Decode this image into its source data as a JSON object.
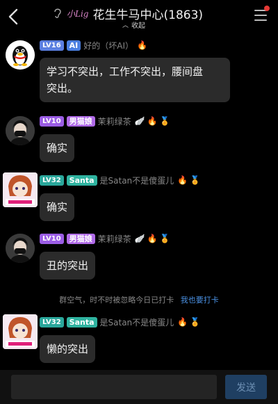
{
  "header": {
    "brand": "小Lig",
    "title": "花生牛马中心(1863)",
    "collapse_label": "收起"
  },
  "messages": [
    {
      "level": "LV16",
      "tag": "AI",
      "nickname": "好的（坏AI）",
      "text_line1": "学习不突出，工作不突出，腰间盘",
      "text_line2": "突出。"
    },
    {
      "level": "LV10",
      "tag": "男猫娘",
      "nickname": "茉莉绿茶",
      "text": "确实"
    },
    {
      "level": "LV32",
      "tag": "Santa",
      "nickname": "是Satan不是傻蛋儿",
      "text": "确实"
    },
    {
      "level": "LV10",
      "tag": "男猫娘",
      "nickname": "茉莉绿茶",
      "text": "丑的突出"
    },
    {
      "level": "LV32",
      "tag": "Santa",
      "nickname": "是Satan不是傻蛋儿",
      "text": "懒的突出"
    }
  ],
  "system": {
    "notice": "群空气，时不时被忽略今日已打卡",
    "link": "我也要打卡"
  },
  "input": {
    "placeholder": "",
    "send_label": "发送"
  },
  "colors": {
    "accent": "#4a90e2",
    "notification_dot": "#e53935"
  }
}
